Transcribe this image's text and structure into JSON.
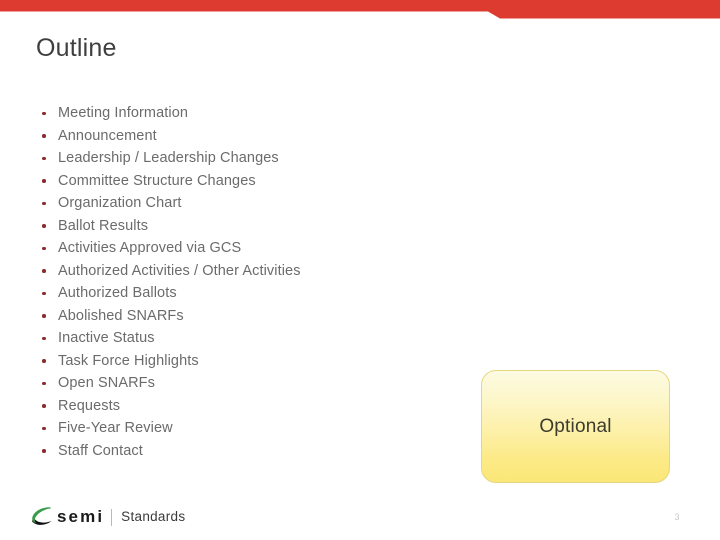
{
  "slide": {
    "title": "Outline",
    "page_number": "3",
    "accent_color": "#dd3b30",
    "bullet_color": "#8c2b2c",
    "text_color": "#6b6b6b",
    "title_color": "#3f3f3f"
  },
  "banner": {
    "name": "top-red-banner",
    "color": "#dd3b30"
  },
  "outline": {
    "items": [
      {
        "label": "Meeting Information"
      },
      {
        "label": "Announcement"
      },
      {
        "label": "Leadership / Leadership Changes"
      },
      {
        "label": "Committee Structure Changes"
      },
      {
        "label": "Organization Chart"
      },
      {
        "label": "Ballot Results"
      },
      {
        "label": "Activities Approved via GCS"
      },
      {
        "label": "Authorized Activities / Other Activities"
      },
      {
        "label": "Authorized Ballots"
      },
      {
        "label": "Abolished SNARFs"
      },
      {
        "label": "Inactive Status"
      },
      {
        "label": "Task Force Highlights"
      },
      {
        "label": "Open SNARFs"
      },
      {
        "label": "Requests"
      },
      {
        "label": "Five-Year Review"
      },
      {
        "label": "Staff Contact"
      }
    ]
  },
  "callout": {
    "label": "Optional",
    "fill_top": "#fdfbe3",
    "fill_bottom": "#fbe778",
    "border_color": "#e5d77f"
  },
  "footer": {
    "logo_wordmark": "semi",
    "logo_subtitle": "Standards",
    "logo_mark_color": "#3a9c4a",
    "logo_mark_shadow_color": "#111111"
  }
}
